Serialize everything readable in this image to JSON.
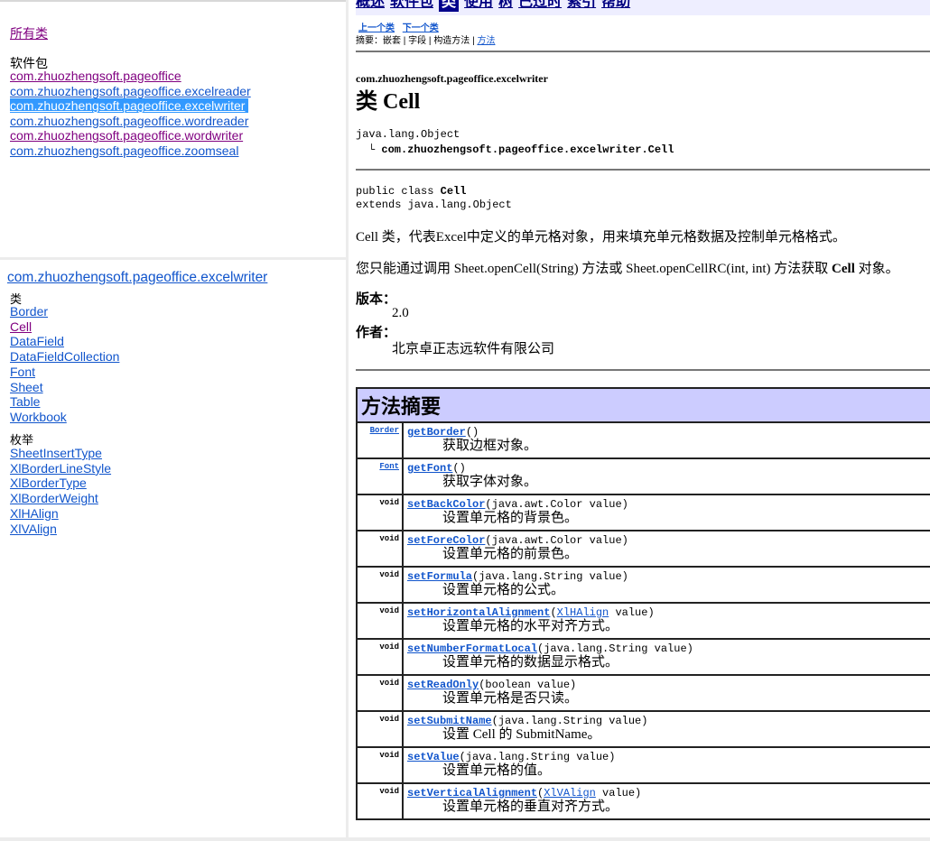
{
  "packages_frame": {
    "all_classes": "所有类",
    "heading": "软件包",
    "packages": [
      {
        "name": "com.zhuozhengsoft.pageoffice",
        "state": "visited"
      },
      {
        "name": "com.zhuozhengsoft.pageoffice.excelreader",
        "state": "normal"
      },
      {
        "name": "com.zhuozhengsoft.pageoffice.excelwriter",
        "state": "selected"
      },
      {
        "name": "com.zhuozhengsoft.pageoffice.wordreader",
        "state": "normal"
      },
      {
        "name": "com.zhuozhengsoft.pageoffice.wordwriter",
        "state": "visited"
      },
      {
        "name": "com.zhuozhengsoft.pageoffice.zoomseal",
        "state": "normal"
      }
    ]
  },
  "classes_frame": {
    "package": "com.zhuozhengsoft.pageoffice.excelwriter",
    "classes_heading": "类",
    "classes": [
      {
        "name": "Border",
        "state": "normal"
      },
      {
        "name": "Cell",
        "state": "visited"
      },
      {
        "name": "DataField",
        "state": "normal"
      },
      {
        "name": "DataFieldCollection",
        "state": "normal"
      },
      {
        "name": "Font",
        "state": "normal"
      },
      {
        "name": "Sheet",
        "state": "normal"
      },
      {
        "name": "Table",
        "state": "normal"
      },
      {
        "name": "Workbook",
        "state": "normal"
      }
    ],
    "enums_heading": "枚举",
    "enums": [
      {
        "name": "SheetInsertType"
      },
      {
        "name": "XlBorderLineStyle"
      },
      {
        "name": "XlBorderType"
      },
      {
        "name": "XlBorderWeight"
      },
      {
        "name": "XlHAlign"
      },
      {
        "name": "XlVAlign"
      }
    ]
  },
  "main": {
    "navbar": {
      "items": [
        "概述",
        "软件包",
        "类",
        "使用",
        "树",
        "已过时",
        "索引",
        "帮助"
      ],
      "active": "类"
    },
    "prev_class": "上一个类",
    "next_class": "下一个类",
    "summary_prefix": "摘要：",
    "summary_items": [
      "嵌套",
      "字段",
      "构造方法",
      "方法"
    ],
    "package_label": "com.zhuozhengsoft.pageoffice.excelwriter",
    "class_title": "类 Cell",
    "inheritance_root": "java.lang.Object",
    "inheritance_child": "com.zhuozhengsoft.pageoffice.excelwriter.Cell",
    "decl_line1_prefix": "public class ",
    "decl_line1_name": "Cell",
    "decl_line2": "extends java.lang.Object",
    "description1": "Cell 类，代表Excel中定义的单元格对象，用来填充单元格数据及控制单元格格式。",
    "description2_prefix": "您只能通过调用 Sheet.openCell(String) 方法或 Sheet.openCellRC(int, int) 方法获取 ",
    "description2_bold": "Cell",
    "description2_suffix": " 对象。",
    "version_label": "版本：",
    "version_value": "2.0",
    "author_label": "作者：",
    "author_value": "北京卓正志远软件有限公司",
    "method_summary_title": "方法摘要",
    "methods": [
      {
        "ret": "Border",
        "ret_link": true,
        "name": "getBorder",
        "params_pre": "()",
        "param_link": "",
        "params_post": "",
        "desc": "获取边框对象。"
      },
      {
        "ret": "Font",
        "ret_link": true,
        "name": "getFont",
        "params_pre": "()",
        "param_link": "",
        "params_post": "",
        "desc": "获取字体对象。"
      },
      {
        "ret": "void",
        "ret_link": false,
        "name": "setBackColor",
        "params_pre": "(java.awt.Color value)",
        "param_link": "",
        "params_post": "",
        "desc": "设置单元格的背景色。"
      },
      {
        "ret": "void",
        "ret_link": false,
        "name": "setForeColor",
        "params_pre": "(java.awt.Color value)",
        "param_link": "",
        "params_post": "",
        "desc": "设置单元格的前景色。"
      },
      {
        "ret": "void",
        "ret_link": false,
        "name": "setFormula",
        "params_pre": "(java.lang.String value)",
        "param_link": "",
        "params_post": "",
        "desc": "设置单元格的公式。"
      },
      {
        "ret": "void",
        "ret_link": false,
        "name": "setHorizontalAlignment",
        "params_pre": "(",
        "param_link": "XlHAlign",
        "params_post": " value)",
        "desc": "设置单元格的水平对齐方式。"
      },
      {
        "ret": "void",
        "ret_link": false,
        "name": "setNumberFormatLocal",
        "params_pre": "(java.lang.String value)",
        "param_link": "",
        "params_post": "",
        "desc": "设置单元格的数据显示格式。"
      },
      {
        "ret": "void",
        "ret_link": false,
        "name": "setReadOnly",
        "params_pre": "(boolean value)",
        "param_link": "",
        "params_post": "",
        "desc": "设置单元格是否只读。"
      },
      {
        "ret": "void",
        "ret_link": false,
        "name": "setSubmitName",
        "params_pre": "(java.lang.String value)",
        "param_link": "",
        "params_post": "",
        "desc": "设置 Cell 的 SubmitName。"
      },
      {
        "ret": "void",
        "ret_link": false,
        "name": "setValue",
        "params_pre": "(java.lang.String value)",
        "param_link": "",
        "params_post": "",
        "desc": "设置单元格的值。"
      },
      {
        "ret": "void",
        "ret_link": false,
        "name": "setVerticalAlignment",
        "params_pre": "(",
        "param_link": "XlVAlign",
        "params_post": " value)",
        "desc": "设置单元格的垂直对齐方式。"
      }
    ]
  }
}
